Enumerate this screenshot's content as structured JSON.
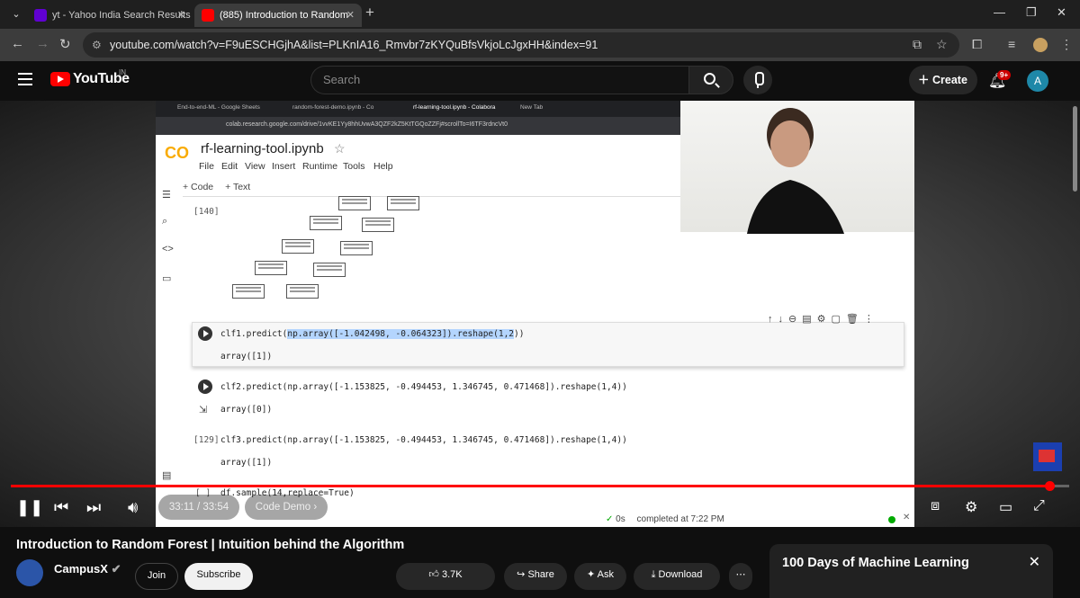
{
  "browser": {
    "tabs": [
      {
        "title": "yt - Yahoo India Search Results",
        "active": false
      },
      {
        "title": "(885) Introduction to Random",
        "active": true
      }
    ],
    "url": "youtube.com/watch?v=F9uESCHGjhA&list=PLKnIA16_Rmvbr7zKYQuBfsVkjoLcJgxHH&index=91",
    "accent": "#ff0000"
  },
  "youtube": {
    "logo": "YouTube",
    "country": "IN",
    "search_placeholder": "Search",
    "create_label": "Create",
    "notifications": "9+",
    "avatar_letter": "A"
  },
  "video_content": {
    "tabs": [
      "End-to-end-ML - Google Sheets",
      "random-forest-demo.ipynb - Co",
      "rf-learning-tool.ipynb - Colabora",
      "New Tab"
    ],
    "url": "colab.research.google.com/drive/1vvKE1Yy8hhUvwA3QZF2kZ5KtTGQoZZFj#scrollTo=I6TF3rdncVt0",
    "logo": "CO",
    "notebook": "rf-learning-tool.ipynb",
    "menu": [
      "File",
      "Edit",
      "View",
      "Insert",
      "Runtime",
      "Tools",
      "Help"
    ],
    "add_code": "+ Code",
    "add_text": "+ Text",
    "cell_140": "[140]",
    "code1_pre": "clf1.predict(",
    "code1_hl": "np.array([-1.042498, -0.064323]).reshape(1,2",
    "code1_post": "))",
    "out1": "array([1])",
    "code2": "clf2.predict(np.array([-1.153825, -0.494453,  1.346745, 0.471468]).reshape(1,4))",
    "out2": "array([0])",
    "cell_129": "[129]",
    "code3": "clf3.predict(np.array([-1.153825, -0.494453,  1.346745, 0.471468]).reshape(1,4))",
    "out3": "array([1])",
    "cell_empty": "[ ]",
    "code4": "df.sample(14,replace=True)",
    "status_time": "0s",
    "status_done": "completed at 7:22 PM"
  },
  "player": {
    "progress_fraction": 0.9812,
    "time": "33:11 / 33:54",
    "chapter": "Code Demo"
  },
  "video_info": {
    "title": "Introduction to Random Forest | Intuition behind the Algorithm",
    "channel": "CampusX",
    "join": "Join",
    "subscribe": "Subscribe",
    "likes": "3.7K",
    "share": "Share",
    "ask": "Ask",
    "download": "Download"
  },
  "playlist": {
    "title": "100 Days of Machine Learning"
  }
}
